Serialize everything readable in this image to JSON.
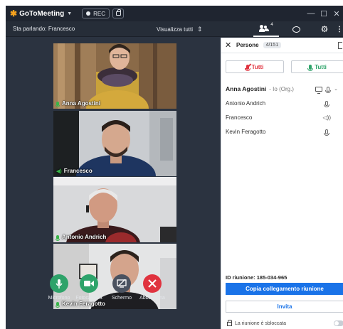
{
  "titlebar": {
    "brand": "GoToMeeting",
    "rec_label": "REC",
    "window_controls": [
      "minimize",
      "maximize",
      "close"
    ]
  },
  "subbar": {
    "speaking": "Sta parlando: Francesco",
    "view_all": "Visualizza tutti",
    "people_count": "4"
  },
  "tiles": [
    {
      "name": "Anna Agostini",
      "audio": "mic"
    },
    {
      "name": "Francesco",
      "audio": "speaker"
    },
    {
      "name": "Antonio Andrich",
      "audio": "mic"
    },
    {
      "name": "Kevin Feragotto",
      "audio": "mic"
    }
  ],
  "controls": {
    "mic": "Microfono",
    "camera": "Fotocamera",
    "screen": "Schermo",
    "leave": "Abbandona"
  },
  "panel": {
    "title": "Persone",
    "count": "4/151",
    "mute_all": "Tutti",
    "unmute_all": "Tutti",
    "host": {
      "name": "Anna Agostini",
      "tag": "- Io (Org.)"
    },
    "people": [
      {
        "name": "Antonio Andrich"
      },
      {
        "name": "Francesco"
      },
      {
        "name": "Kevin Feragotto"
      }
    ],
    "meeting_id": "ID riunione: 185-034-965",
    "copy_link": "Copia collegamento riunione",
    "invite": "Invita",
    "unlocked": "La riunione è sbloccata"
  },
  "colors": {
    "accent_blue": "#1a73e8",
    "mic_green": "#2ea36a",
    "leave_red": "#e0333f",
    "brand_orange": "#f6a21e"
  }
}
